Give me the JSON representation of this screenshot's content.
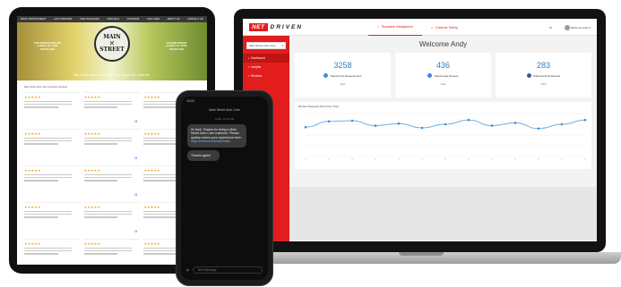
{
  "tablet": {
    "nav_items": [
      "BOOK APPOINTMENT",
      "AUTO REPAIRS",
      "TIRE PACKAGES",
      "SPECIALS",
      "COUPONS",
      "CAR CARE",
      "ABOUT US",
      "CONTACT US"
    ],
    "address_left": [
      "1610 WASHINGTON AVE",
      "ALBANY, NY 12222",
      "518-555-1234"
    ],
    "address_right": [
      "176 MAIN STREET",
      "ALBANY, NY 12207",
      "518-555-1212"
    ],
    "logo_name": [
      "MAIN",
      "STREET"
    ],
    "tagline": "We have the tools and we have the talent!",
    "reviews_caption": "Main Street Auto Care Customer Reviews"
  },
  "dashboard": {
    "brand": {
      "net": "NET",
      "driven": "DRIVEN"
    },
    "tabs": [
      {
        "label": "Reputation Management",
        "active": true
      },
      {
        "label": "Customer Texting",
        "active": false
      }
    ],
    "user_label": "Welcome Andy",
    "location_select": "Main Street Auto Care",
    "menu": [
      {
        "label": "Dashboard",
        "active": true
      },
      {
        "label": "Insights",
        "active": false
      },
      {
        "label": "Reviews",
        "active": false
      }
    ],
    "welcome": "Welcome Andy",
    "stats": [
      {
        "value": "3258",
        "label": "Total Service Requests Sent",
        "link": "View",
        "icon": "send-icon",
        "color": "#3a8fd6"
      },
      {
        "value": "436",
        "label": "Total Google Reviews",
        "link": "View",
        "icon": "google-icon",
        "color": "#4285f4"
      },
      {
        "value": "283",
        "label": "Total Facebook Reviews",
        "link": "View",
        "icon": "facebook-icon",
        "color": "#3b5998"
      }
    ],
    "chart_title": "Review Requests Sent Over Time"
  },
  "chart_data": {
    "type": "line",
    "title": "Review Requests Sent Over Time",
    "x": [
      "",
      "",
      "",
      "",
      "",
      "",
      "",
      "",
      "",
      "",
      "",
      ""
    ],
    "series": [
      {
        "values": [
          205,
          245,
          250,
          215,
          230,
          200,
          225,
          255,
          215,
          235,
          195,
          225,
          255
        ]
      }
    ],
    "ylim": [
      0,
      300
    ],
    "grid": true
  },
  "phone": {
    "status": "10:24",
    "sender": "Main Street Auto Care",
    "date": "Today 10:22 AM",
    "message_1_text": "Hi Jack, Thanks for being a Main Street Auto Care customer. Please quickly review your experience here:",
    "message_1_link": "https://review.example/msac",
    "message_2": "Thanks again!",
    "input_placeholder": "Text Message"
  },
  "colors": {
    "brand_red": "#e31d1d",
    "accent_blue": "#2f7fbf",
    "star": "#f5a623"
  }
}
